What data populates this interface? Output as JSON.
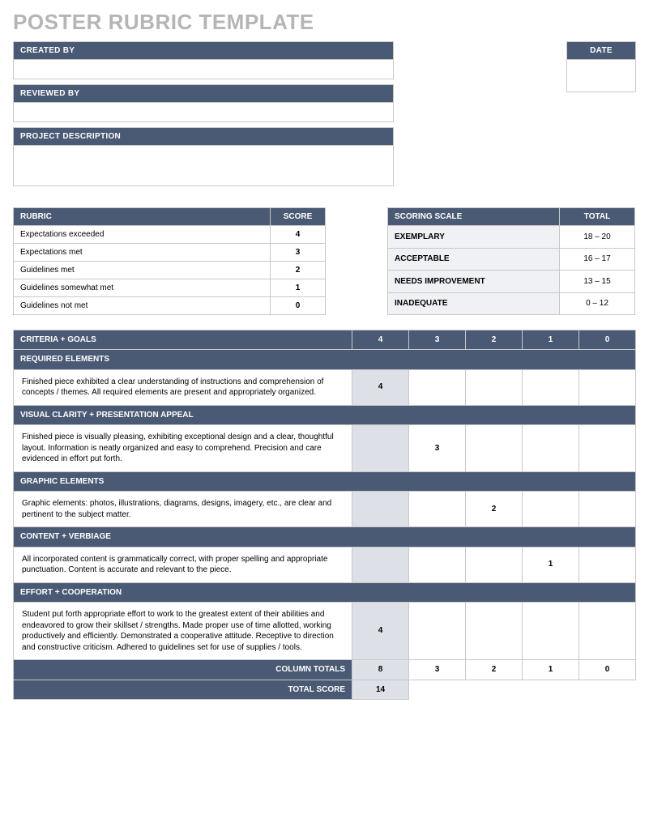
{
  "title": "POSTER RUBRIC TEMPLATE",
  "meta": {
    "created_by_label": "CREATED BY",
    "reviewed_by_label": "REVIEWED BY",
    "project_desc_label": "PROJECT DESCRIPTION",
    "date_label": "DATE"
  },
  "rubric": {
    "header_label": "RUBRIC",
    "score_label": "SCORE",
    "rows": [
      {
        "label": "Expectations exceeded",
        "score": "4"
      },
      {
        "label": "Expectations met",
        "score": "3"
      },
      {
        "label": "Guidelines met",
        "score": "2"
      },
      {
        "label": "Guidelines somewhat met",
        "score": "1"
      },
      {
        "label": "Guidelines not met",
        "score": "0"
      }
    ]
  },
  "scoring": {
    "header_label": "SCORING SCALE",
    "total_label": "TOTAL",
    "rows": [
      {
        "label": "EXEMPLARY",
        "range": "18 – 20"
      },
      {
        "label": "ACCEPTABLE",
        "range": "16 – 17"
      },
      {
        "label": "NEEDS IMPROVEMENT",
        "range": "13 – 15"
      },
      {
        "label": "INADEQUATE",
        "range": "0 – 12"
      }
    ]
  },
  "criteria": {
    "header_label": "CRITERIA + GOALS",
    "cols": [
      "4",
      "3",
      "2",
      "1",
      "0"
    ],
    "sections": [
      {
        "title": "REQUIRED ELEMENTS",
        "desc": "Finished piece exhibited a clear understanding of instructions and comprehension of concepts / themes.  All required elements are present and appropriately organized.",
        "vals": [
          "4",
          "",
          "",
          "",
          ""
        ]
      },
      {
        "title": "VISUAL CLARITY + PRESENTATION APPEAL",
        "desc": "Finished piece is visually pleasing, exhibiting exceptional design and a clear, thoughtful layout.  Information is neatly organized and easy to comprehend.  Precision and care evidenced in effort put forth.",
        "vals": [
          "",
          "3",
          "",
          "",
          ""
        ]
      },
      {
        "title": "GRAPHIC ELEMENTS",
        "desc": "Graphic elements: photos, illustrations, diagrams, designs, imagery, etc., are clear and pertinent to the subject matter.",
        "vals": [
          "",
          "",
          "2",
          "",
          ""
        ]
      },
      {
        "title": "CONTENT + VERBIAGE",
        "desc": "All incorporated content is grammatically correct, with proper spelling and appropriate punctuation.  Content is accurate and relevant to the piece.",
        "vals": [
          "",
          "",
          "",
          "1",
          ""
        ]
      },
      {
        "title": "EFFORT + COOPERATION",
        "desc": "Student put forth appropriate effort to work to the greatest extent of their abilities and endeavored to grow their skillset / strengths.  Made proper use of time allotted, working productively and efficiently.  Demonstrated a cooperative attitude.  Receptive to direction and constructive criticism.  Adhered to guidelines set for use of supplies / tools.",
        "vals": [
          "4",
          "",
          "",
          "",
          ""
        ]
      }
    ],
    "column_totals_label": "COLUMN TOTALS",
    "column_totals": [
      "8",
      "3",
      "2",
      "1",
      "0"
    ],
    "total_score_label": "TOTAL SCORE",
    "total_score": "14"
  }
}
